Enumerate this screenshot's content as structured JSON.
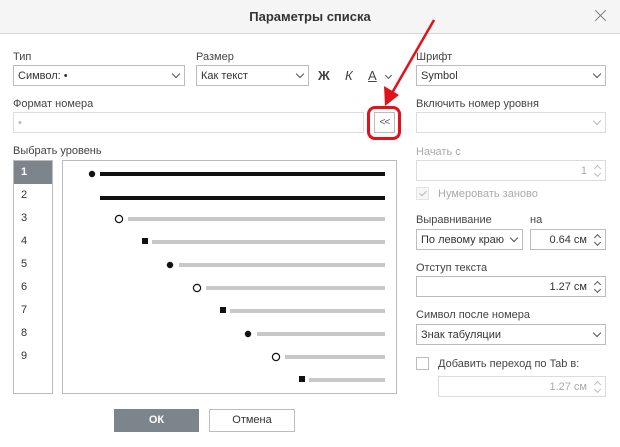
{
  "dialog": {
    "title": "Параметры списка"
  },
  "type": {
    "label": "Тип",
    "value": "Символ: •"
  },
  "size": {
    "label": "Размер",
    "value": "Как текст"
  },
  "format_buttons": {
    "bold": "Ж",
    "italic": "К",
    "color": "А"
  },
  "font": {
    "label": "Шрифт",
    "value": "Symbol"
  },
  "number_format": {
    "label": "Формат номера",
    "value": "•",
    "insert_button": "<<"
  },
  "include_level": {
    "label": "Включить номер уровня",
    "value": ""
  },
  "choose_level": {
    "label": "Выбрать уровень"
  },
  "levels": [
    "1",
    "2",
    "3",
    "4",
    "5",
    "6",
    "7",
    "8",
    "9"
  ],
  "selected_level": "1",
  "preview_bullets": [
    "filled-circle",
    "filled-circle",
    "hollow-circle",
    "filled-square",
    "filled-circle",
    "hollow-circle",
    "filled-square",
    "filled-circle",
    "hollow-circle",
    "filled-square"
  ],
  "start_at": {
    "label": "Начать с",
    "value": "1"
  },
  "restart": {
    "label": "Нумеровать заново",
    "checked": true,
    "disabled": true
  },
  "alignment": {
    "label": "Выравнивание",
    "value": "По левому краю",
    "at_label": "на",
    "at_value": "0.64 см"
  },
  "indent": {
    "label": "Отступ текста",
    "value": "1.27 см"
  },
  "symbol_after": {
    "label": "Символ после номера",
    "value": "Знак табуляции"
  },
  "tab_stop": {
    "label": "Добавить переход по Tab в:",
    "checked": false,
    "value": "1.27 см"
  },
  "actions": {
    "ok": "ОК",
    "cancel": "Отмена"
  },
  "colors": {
    "accent_red": "#e0131a",
    "selected_bg": "#7d858c"
  }
}
